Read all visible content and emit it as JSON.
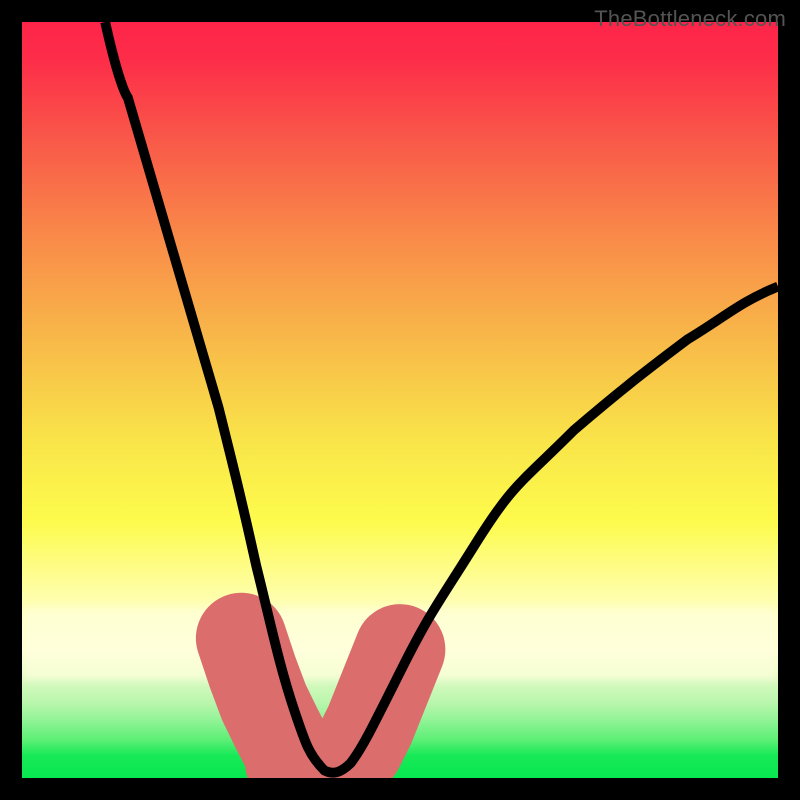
{
  "watermark": "TheBottleneck.com",
  "chart_data": {
    "type": "line",
    "title": "",
    "xlabel": "",
    "ylabel": "",
    "xlim": [
      0,
      100
    ],
    "ylim": [
      0,
      100
    ],
    "grid": false,
    "legend": false,
    "curve_description": "V-shaped bottleneck curve: falls from top-left down to a flat minimum near the bottom around x≈35–40, then rises to the right side at roughly x=100, y≈65.",
    "series": [
      {
        "name": "black-curve",
        "x": [
          11,
          14,
          18,
          22,
          26,
          29,
          31,
          34,
          36,
          38,
          40,
          42,
          43.5,
          46,
          50,
          55,
          60,
          66,
          73,
          80,
          88,
          95,
          100
        ],
        "y": [
          100,
          90,
          76,
          63,
          49,
          37,
          28,
          18,
          9,
          3,
          1,
          1,
          2,
          6,
          14,
          23,
          31,
          39,
          46,
          52,
          58,
          63,
          65
        ]
      },
      {
        "name": "pink-highlight-left",
        "x": [
          29,
          30.5,
          32,
          33.7,
          35,
          36.2
        ],
        "y": [
          18.5,
          14,
          10,
          6.5,
          4,
          2.5
        ]
      },
      {
        "name": "pink-highlight-bottom",
        "x": [
          35.5,
          38,
          41,
          43
        ],
        "y": [
          2,
          1,
          1,
          1.5
        ]
      },
      {
        "name": "pink-highlight-right",
        "x": [
          44.5,
          46,
          48,
          50
        ],
        "y": [
          4,
          7,
          12,
          17
        ]
      }
    ]
  }
}
